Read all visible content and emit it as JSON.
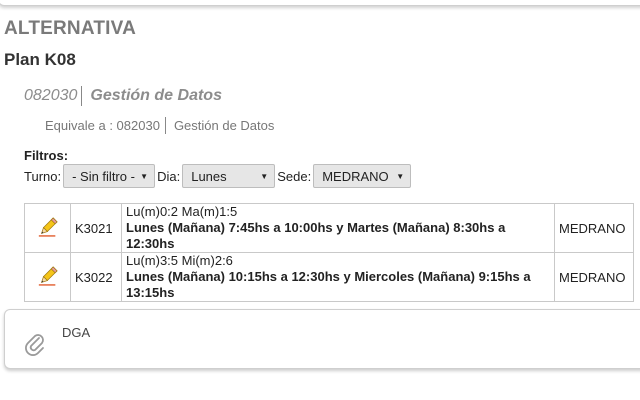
{
  "header": {
    "section_title": "ALTERNATIVA",
    "plan_title": "Plan K08"
  },
  "subject": {
    "code": "082030",
    "name": "Gestión de Datos"
  },
  "equivalence": {
    "label": "Equivale a : 082030",
    "name": "Gestión de Datos"
  },
  "filters": {
    "title": "Filtros:",
    "turno_label": "Turno:",
    "turno_value": "- Sin filtro -",
    "dia_label": "Dia:",
    "dia_value": "Lunes",
    "sede_label": "Sede:",
    "sede_value": "MEDRANO"
  },
  "courses": [
    {
      "code": "K3021",
      "days": "Lu(m)0:2 Ma(m)1:5",
      "schedule": "Lunes (Mañana) 7:45hs a 10:00hs y Martes (Mañana) 8:30hs a 12:30hs",
      "sede": "MEDRANO"
    },
    {
      "code": "K3022",
      "days": "Lu(m)3:5 Mi(m)2:6",
      "schedule": "Lunes (Mañana) 10:15hs a 12:30hs y Miercoles (Mañana) 9:15hs a 13:15hs",
      "sede": "MEDRANO"
    }
  ],
  "note": {
    "icon": "paperclip-icon",
    "text": "DGA"
  },
  "icons": {
    "edit": "pencil-icon"
  },
  "colors": {
    "title_gray": "#7a7a7a",
    "pencil_yellow": "#f5c518",
    "pencil_tip": "#e05a2a"
  }
}
